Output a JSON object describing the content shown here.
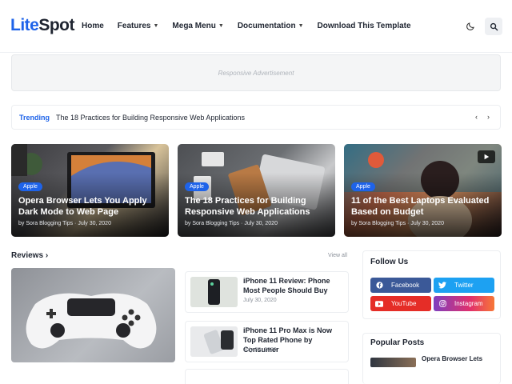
{
  "header": {
    "logo_part1": "Lite",
    "logo_part2": "Spot",
    "nav": [
      {
        "label": "Home",
        "dropdown": false
      },
      {
        "label": "Features",
        "dropdown": true
      },
      {
        "label": "Mega Menu",
        "dropdown": true
      },
      {
        "label": "Documentation",
        "dropdown": true
      },
      {
        "label": "Download This Template",
        "dropdown": false
      }
    ],
    "icons": [
      "moon-icon",
      "search-icon"
    ]
  },
  "ad": {
    "text": "Responsive Advertisement"
  },
  "trending": {
    "label": "Trending",
    "title": "The 18 Practices for Building Responsive Web Applications"
  },
  "featured": [
    {
      "badge": "Apple",
      "title": "Opera Browser Lets You Apply Dark Mode to Web Page",
      "meta": "by Sora Blogging Tips · July 30, 2020"
    },
    {
      "badge": "Apple",
      "title": "The 18 Practices for Building Responsive Web Applications",
      "meta": "by Sora Blogging Tips · July 30, 2020"
    },
    {
      "badge": "Apple",
      "title": "11 of the Best Laptops Evaluated Based on Budget",
      "meta": "by Sora Blogging Tips · July 30, 2020",
      "has_video": true
    }
  ],
  "reviews": {
    "title": "Reviews",
    "view_all": "View all",
    "items": [
      {
        "title": "iPhone 11 Review: Phone Most People Should Buy",
        "date": "July 30, 2020"
      },
      {
        "title": "iPhone 11 Pro Max is Now Top Rated Phone by Consumer",
        "date": "July 30, 2020"
      }
    ]
  },
  "sidebar": {
    "follow_title": "Follow Us",
    "social": [
      {
        "label": "Facebook",
        "icon": "facebook-icon",
        "color": "#3b5998"
      },
      {
        "label": "Twitter",
        "icon": "twitter-icon",
        "color": "#1da1f2"
      },
      {
        "label": "YouTube",
        "icon": "youtube-icon",
        "color": "#e52d27"
      },
      {
        "label": "Instagram",
        "icon": "instagram-icon",
        "color": "#e1306c"
      }
    ],
    "popular_title": "Popular Posts",
    "popular": [
      {
        "title": "Opera Browser Lets"
      }
    ]
  },
  "colors": {
    "accent": "#1e63e9",
    "text": "#1e2430",
    "muted": "#8a9099"
  }
}
